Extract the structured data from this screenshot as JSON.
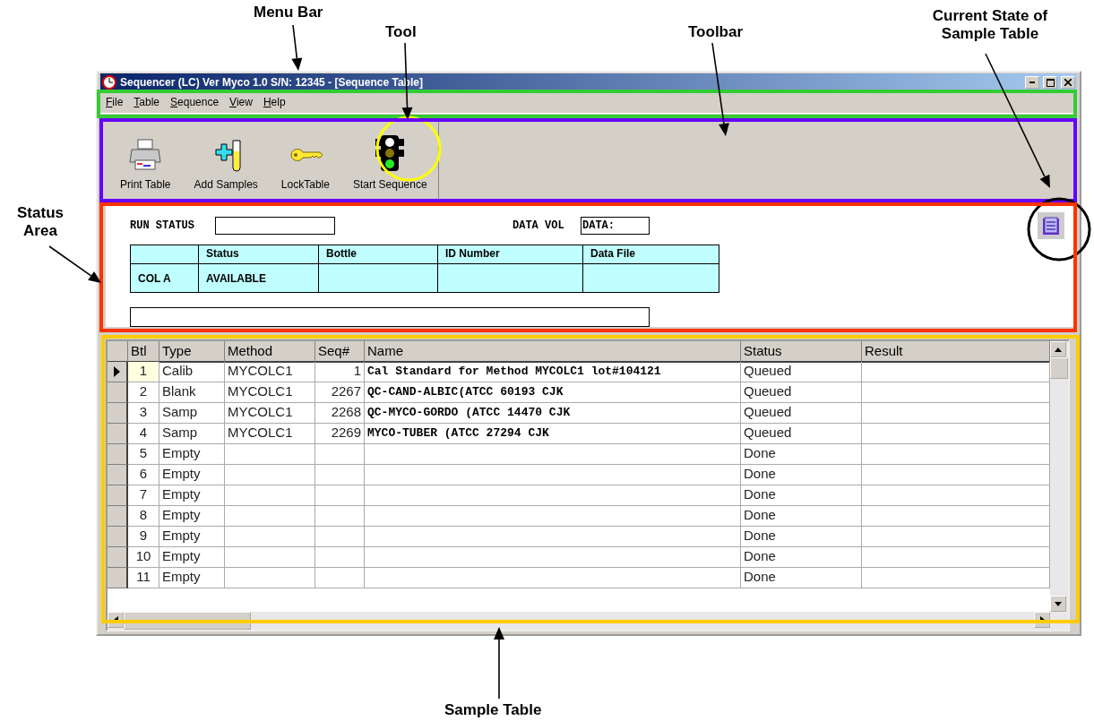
{
  "window": {
    "title": "Sequencer (LC) Ver Myco 1.0 S/N: 12345 - [Sequence Table]"
  },
  "menu": [
    "File",
    "Table",
    "Sequence",
    "View",
    "Help"
  ],
  "toolbar": [
    {
      "label": "Print Table",
      "kind": "printer"
    },
    {
      "label": "Add Samples",
      "kind": "add"
    },
    {
      "label": "LockTable",
      "kind": "key"
    },
    {
      "label": "Start Sequence",
      "kind": "light"
    }
  ],
  "status_area": {
    "run_status_label": "RUN STATUS",
    "data_vol_label": "DATA VOL",
    "data_vol_value": "DATA:",
    "columns": [
      "Status",
      "Bottle",
      "ID Number",
      "Data File"
    ],
    "rows": [
      {
        "name": "COL A",
        "status": "AVAILABLE"
      }
    ]
  },
  "table": {
    "columns": [
      "Btl",
      "Type",
      "Method",
      "Seq#",
      "Name",
      "Status",
      "Result"
    ],
    "rows": [
      {
        "btl": "1",
        "type": "Calib",
        "method": "MYCOLC1",
        "seq": "1",
        "name": "Cal Standard for Method MYCOLC1 lot#104121",
        "status": "Queued",
        "selected": true
      },
      {
        "btl": "2",
        "type": "Blank",
        "method": "MYCOLC1",
        "seq": "2267",
        "name": "QC-CAND-ALBIC(ATCC 60193 CJK",
        "status": "Queued",
        "selected": false
      },
      {
        "btl": "3",
        "type": "Samp",
        "method": "MYCOLC1",
        "seq": "2268",
        "name": "QC-MYCO-GORDO (ATCC 14470 CJK",
        "status": "Queued",
        "selected": false
      },
      {
        "btl": "4",
        "type": "Samp",
        "method": "MYCOLC1",
        "seq": "2269",
        "name": "MYCO-TUBER (ATCC 27294 CJK",
        "status": "Queued",
        "selected": false
      },
      {
        "btl": "5",
        "type": "Empty",
        "status": "Done",
        "selected": false
      },
      {
        "btl": "6",
        "type": "Empty",
        "status": "Done",
        "selected": false
      },
      {
        "btl": "7",
        "type": "Empty",
        "status": "Done",
        "selected": false
      },
      {
        "btl": "8",
        "type": "Empty",
        "status": "Done",
        "selected": false
      },
      {
        "btl": "9",
        "type": "Empty",
        "status": "Done",
        "selected": false
      },
      {
        "btl": "10",
        "type": "Empty",
        "status": "Done",
        "selected": false
      },
      {
        "btl": "11",
        "type": "Empty",
        "status": "Done",
        "selected": false
      }
    ]
  },
  "annotations": [
    {
      "label": "Menu Bar",
      "kind": "frame",
      "color": "#33cc33"
    },
    {
      "label": "Tool",
      "kind": "circle",
      "color": "#ffff00"
    },
    {
      "label": "Toolbar",
      "kind": "frame",
      "color": "#6600ff"
    },
    {
      "label": "Current State of Sample Table",
      "kind": "circle",
      "color": "#000000"
    },
    {
      "label": "Status Area",
      "kind": "frame",
      "color": "#ff3300"
    },
    {
      "label": "Sample Table",
      "kind": "frame",
      "color": "#ffcc00"
    }
  ]
}
